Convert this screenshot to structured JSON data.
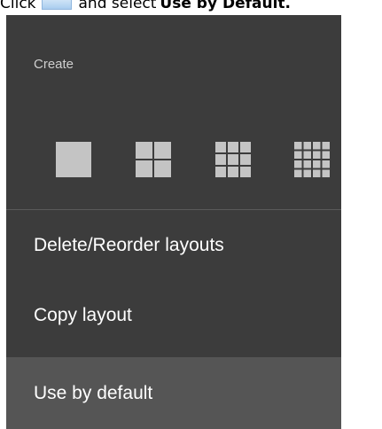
{
  "caption": {
    "prefix": "Click",
    "middle": "and select",
    "bold": "Use by Default."
  },
  "menu": {
    "section_label": "Create",
    "grid_options": [
      {
        "name": "1x1",
        "cells": 1
      },
      {
        "name": "2x2",
        "cells": 2
      },
      {
        "name": "3x3",
        "cells": 3
      },
      {
        "name": "4x4",
        "cells": 4
      }
    ],
    "items": [
      {
        "label": "Delete/Reorder layouts"
      },
      {
        "label": "Copy layout"
      },
      {
        "label": "Use by default",
        "highlighted": true
      }
    ]
  },
  "colors": {
    "menu_background": "#3c3c3c",
    "highlight_background": "#555555",
    "grid_icon": "#c4c4c4",
    "text": "#ffffff"
  }
}
